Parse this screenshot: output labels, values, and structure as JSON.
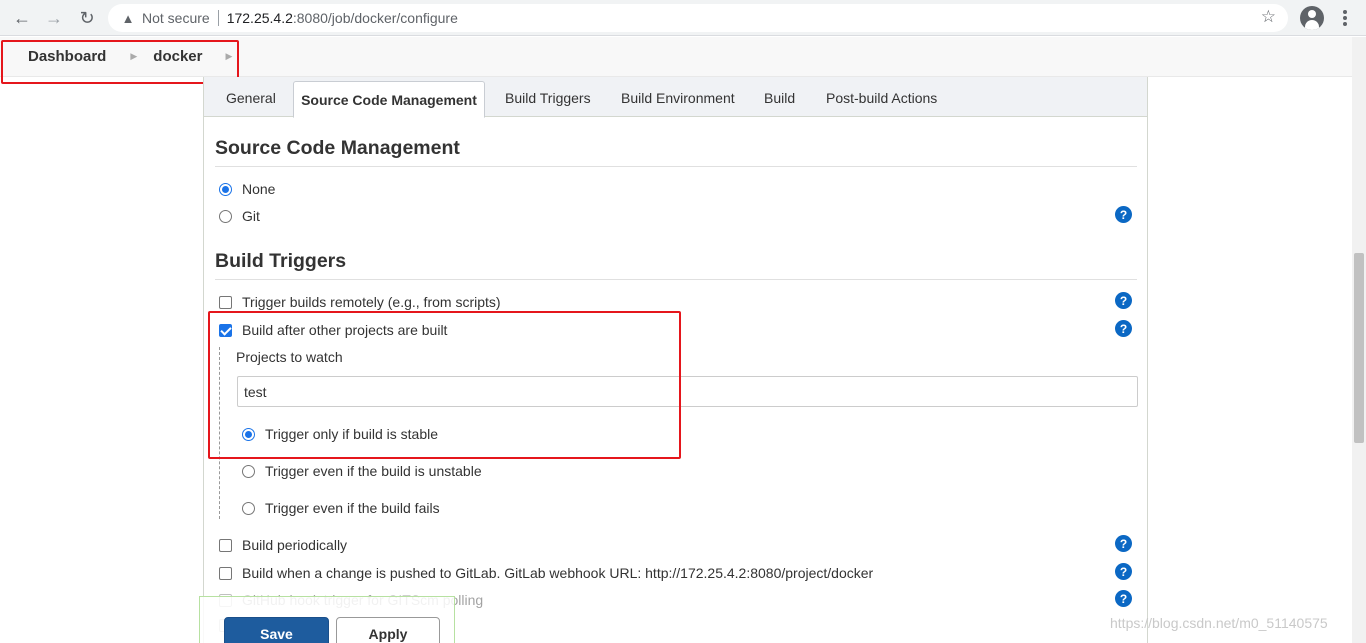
{
  "browser": {
    "security_label": "Not secure",
    "url_host": "172.25.4.2",
    "url_path": ":8080/job/docker/configure"
  },
  "breadcrumb": {
    "items": [
      "Dashboard",
      "docker"
    ]
  },
  "tabs": {
    "general": "General",
    "scm": "Source Code Management",
    "build_triggers": "Build Triggers",
    "build_environment": "Build Environment",
    "build": "Build",
    "post_build": "Post-build Actions"
  },
  "scm": {
    "title": "Source Code Management",
    "option_none": "None",
    "option_git": "Git",
    "selected": "None"
  },
  "build_triggers": {
    "title": "Build Triggers",
    "trigger_remote": "Trigger builds remotely (e.g., from scripts)",
    "build_after": "Build after other projects are built",
    "projects_to_watch_label": "Projects to watch",
    "projects_to_watch_value": "test",
    "trigger_stable": "Trigger only if build is stable",
    "trigger_unstable": "Trigger even if the build is unstable",
    "trigger_fails": "Trigger even if the build fails",
    "build_periodically": "Build periodically",
    "gitlab_push": "Build when a change is pushed to GitLab. GitLab webhook URL: http://172.25.4.2:8080/project/docker",
    "github_hook": "GitHub hook trigger for GITScm polling"
  },
  "actions": {
    "save": "Save",
    "apply": "Apply"
  },
  "watermark": "https://blog.csdn.net/m0_51140575",
  "colors": {
    "highlight_red": "#e5161c",
    "help_blue": "#0b68c4",
    "save_blue": "#1e5c9e",
    "check_blue": "#1a73e8"
  },
  "icons": [
    "back-arrow-icon",
    "forward-arrow-icon",
    "reload-icon",
    "warning-icon",
    "star-icon",
    "account-icon",
    "menu-icon",
    "help-icon"
  ]
}
